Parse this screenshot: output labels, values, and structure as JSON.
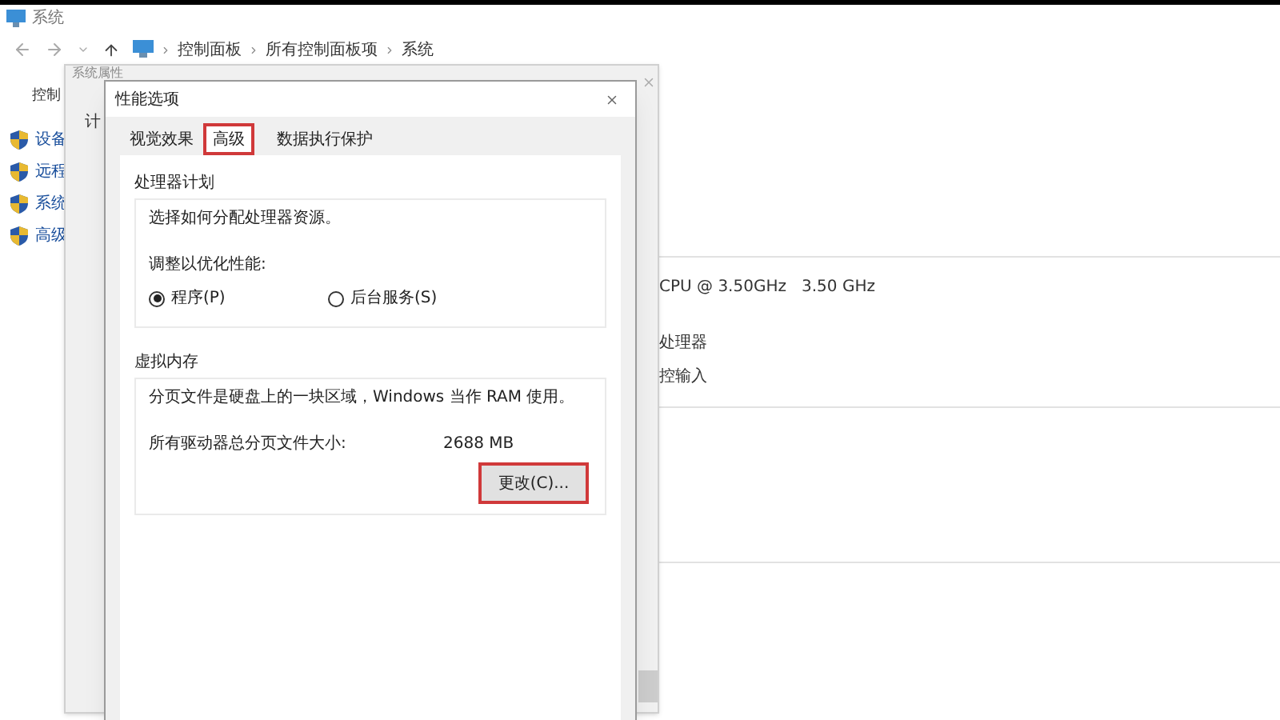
{
  "window": {
    "title": "系统"
  },
  "breadcrumb": [
    "控制面板",
    "所有控制面板项",
    "系统"
  ],
  "sidebar": {
    "heading": "控制",
    "items": [
      {
        "label": "设备"
      },
      {
        "label": "远程"
      },
      {
        "label": "系统"
      },
      {
        "label": "高级"
      }
    ]
  },
  "details": [
    "CPU @ 3.50GHz   3.50 GHz",
    "处理器",
    "控输入"
  ],
  "system_properties": {
    "title": "系统属性",
    "tab": "计"
  },
  "performance_options": {
    "title": "性能选项",
    "tabs": [
      {
        "label": "视觉效果",
        "selected": false,
        "highlighted": false
      },
      {
        "label": "高级",
        "selected": true,
        "highlighted": true
      },
      {
        "label": "数据执行保护",
        "selected": false,
        "highlighted": false
      }
    ],
    "processor": {
      "title": "处理器计划",
      "description": "选择如何分配处理器资源。",
      "prompt": "调整以优化性能:",
      "options": [
        {
          "label": "程序(P)",
          "selected": true
        },
        {
          "label": "后台服务(S)",
          "selected": false
        }
      ]
    },
    "virtual_memory": {
      "title": "虚拟内存",
      "description": "分页文件是硬盘上的一块区域，Windows 当作 RAM 使用。",
      "size_label": "所有驱动器总分页文件大小:",
      "size_value": "2688 MB",
      "button": {
        "label": "更改(C)...",
        "highlighted": true
      }
    }
  }
}
